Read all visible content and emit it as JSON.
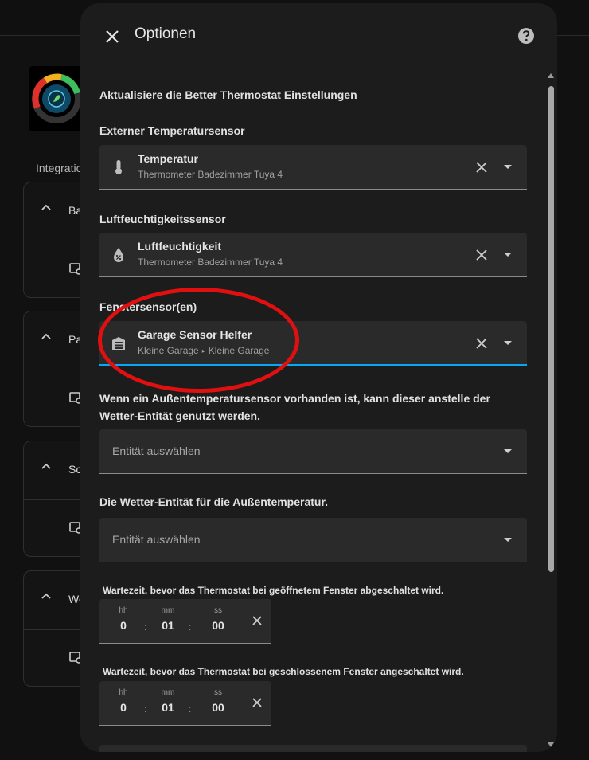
{
  "background": {
    "section_label": "Integratio",
    "cards": [
      {
        "label": "Ba"
      },
      {
        "label": "Pa"
      },
      {
        "label": "Sc"
      },
      {
        "label": "Wo"
      }
    ]
  },
  "dialog": {
    "title": "Optionen",
    "close_icon": "close-icon",
    "help_icon": "help-circle-icon",
    "intro": "Aktualisiere die Better Thermostat Einstellungen",
    "external_temp": {
      "label": "Externer Temperatursensor",
      "icon": "thermometer-icon",
      "entity": "Temperatur",
      "device": "Thermometer Badezimmer Tuya 4"
    },
    "humidity": {
      "label": "Luftfeuchtigkeitssensor",
      "icon": "water-percent-icon",
      "entity": "Luftfeuchtigkeit",
      "device": "Thermometer Badezimmer Tuya 4"
    },
    "window": {
      "label": "Fenstersensor(en)",
      "icon": "garage-icon",
      "entity": "Garage Sensor Helfer",
      "area": "Kleine Garage",
      "device": "Kleine Garage"
    },
    "outdoor_desc": "Wenn ein Außentemperatursensor vorhanden ist, kann dieser anstelle der Wetter-Entität genutzt werden.",
    "outdoor_placeholder": "Entität auswählen",
    "weather_label": "Die Wetter-Entität für die Außentemperatur.",
    "weather_placeholder": "Entität auswählen",
    "window_open_delay": {
      "label": "Wartezeit, bevor das Thermostat bei geöffnetem Fenster abgeschaltet wird.",
      "hh_label": "hh",
      "mm_label": "mm",
      "ss_label": "ss",
      "hh": "0",
      "mm": "01",
      "ss": "00"
    },
    "window_close_delay": {
      "label": "Wartezeit, bevor das Thermostat bei geschlossenem Fenster angeschaltet wird.",
      "hh_label": "hh",
      "mm_label": "mm",
      "ss_label": "ss",
      "hh": "0",
      "mm": "01",
      "ss": "00"
    },
    "colors": {
      "dialog_bg": "#1c1c1c",
      "field_bg": "#2a2a2a",
      "accent": "#03a9f4",
      "highlight": "#e01010"
    }
  }
}
